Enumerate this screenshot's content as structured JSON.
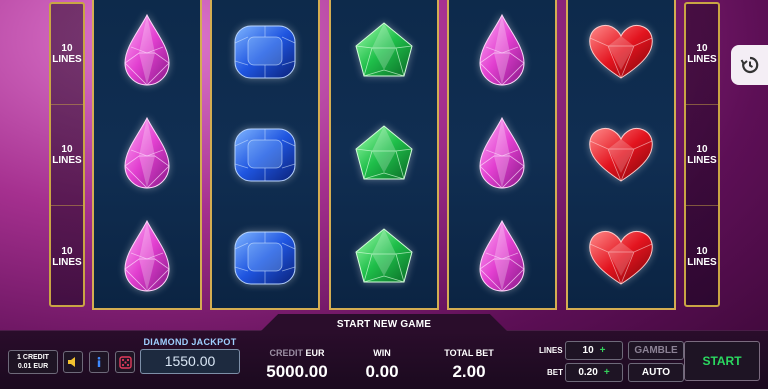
{
  "reels": [
    [
      "pink-gem",
      "pink-gem",
      "pink-gem"
    ],
    [
      "blue-gem",
      "blue-gem",
      "blue-gem"
    ],
    [
      "green-gem",
      "green-gem",
      "green-gem"
    ],
    [
      "pink-gem",
      "pink-gem",
      "pink-gem"
    ],
    [
      "red-heart",
      "red-heart",
      "red-heart"
    ]
  ],
  "line_indicators": {
    "left": [
      {
        "num": "10",
        "word": "LINES"
      },
      {
        "num": "10",
        "word": "LINES"
      },
      {
        "num": "10",
        "word": "LINES"
      }
    ],
    "right": [
      {
        "num": "10",
        "word": "LINES"
      },
      {
        "num": "10",
        "word": "LINES"
      },
      {
        "num": "10",
        "word": "LINES"
      }
    ]
  },
  "history_icon": "history-icon",
  "status_text": "START NEW GAME",
  "denomination": {
    "line1": "1 CREDIT",
    "line2": "0.01 EUR"
  },
  "icon_buttons": [
    "sound-icon",
    "info-icon",
    "dice-icon"
  ],
  "jackpot": {
    "label": "DIAMOND JACKPOT",
    "value": "1550.00"
  },
  "credit": {
    "label": "CREDIT",
    "currency": "EUR",
    "value": "5000.00"
  },
  "win": {
    "label": "WIN",
    "value": "0.00"
  },
  "total_bet": {
    "label": "TOTAL BET",
    "value": "2.00"
  },
  "controls": {
    "lines_label": "LINES",
    "lines_value": "10",
    "lines_plus": "+",
    "bet_label": "BET",
    "bet_value": "0.20",
    "bet_plus": "+",
    "gamble": "GAMBLE",
    "auto": "AUTO",
    "start": "START"
  },
  "colors": {
    "gold_frame": "#d4ad52",
    "start_green": "#2bd860",
    "plus_green": "#34d15a"
  }
}
